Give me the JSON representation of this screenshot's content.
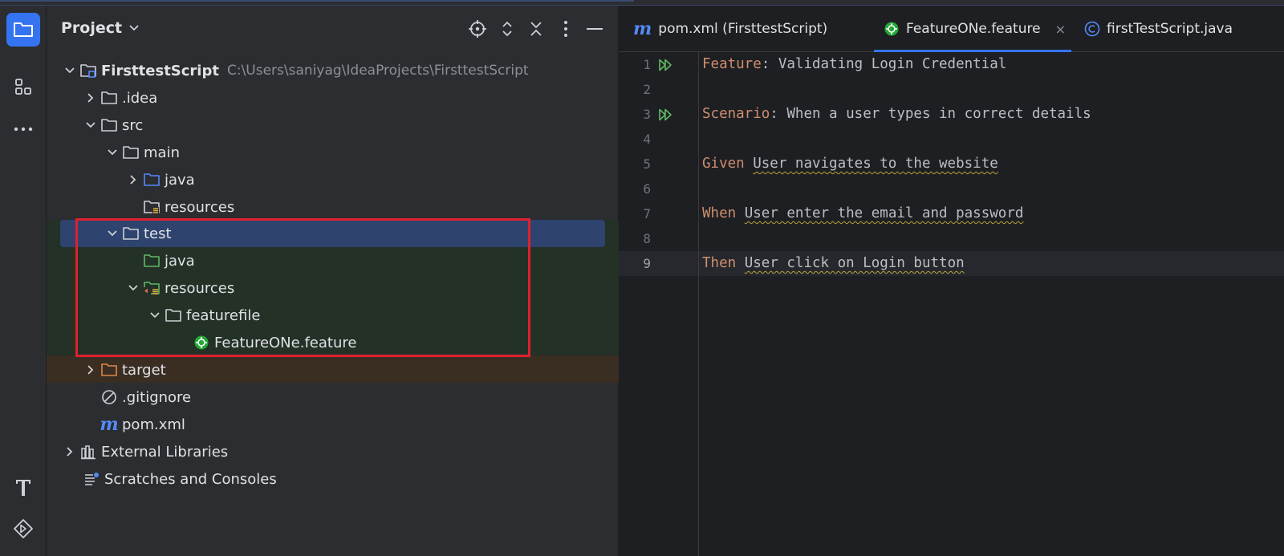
{
  "project_panel": {
    "title": "Project",
    "tree": [
      {
        "label": "FirsttestScript",
        "path": "C:\\Users\\saniyag\\IdeaProjects\\FirsttestScript"
      },
      {
        "label": ".idea"
      },
      {
        "label": "src"
      },
      {
        "label": "main"
      },
      {
        "label": "java"
      },
      {
        "label": "resources"
      },
      {
        "label": "test"
      },
      {
        "label": "java"
      },
      {
        "label": "resources"
      },
      {
        "label": "featurefile"
      },
      {
        "label": "FeatureONe.feature"
      },
      {
        "label": "target"
      },
      {
        "label": ".gitignore"
      },
      {
        "label": "pom.xml"
      },
      {
        "label": "External Libraries"
      },
      {
        "label": "Scratches and Consoles"
      }
    ]
  },
  "editor": {
    "tabs": [
      {
        "label": "pom.xml (FirsttestScript)",
        "icon": "maven-icon"
      },
      {
        "label": "FeatureONe.feature",
        "icon": "cucumber-icon",
        "close": "×"
      },
      {
        "label": "firstTestScript.java",
        "icon": "class-icon"
      }
    ],
    "lines": [
      {
        "num": "1",
        "keyword": "Feature",
        "rest": ": Validating Login Credential"
      },
      {
        "num": "2",
        "keyword": "",
        "rest": ""
      },
      {
        "num": "3",
        "keyword": "Scenario",
        "rest": ": When a user types in correct details"
      },
      {
        "num": "4",
        "keyword": "",
        "rest": ""
      },
      {
        "num": "5",
        "keyword": "Given",
        "rest": "User navigates to the website"
      },
      {
        "num": "6",
        "keyword": "",
        "rest": ""
      },
      {
        "num": "7",
        "keyword": "When",
        "rest": "User enter the email and password"
      },
      {
        "num": "8",
        "keyword": "",
        "rest": ""
      },
      {
        "num": "9",
        "keyword": "Then",
        "rest": "User click on Login button"
      }
    ]
  },
  "colors": {
    "accent": "#3574f0",
    "keyword": "#cf8e6d",
    "highlight_box": "#e0202e",
    "test_bg": "#233126",
    "target_bg": "#3a2e22"
  }
}
